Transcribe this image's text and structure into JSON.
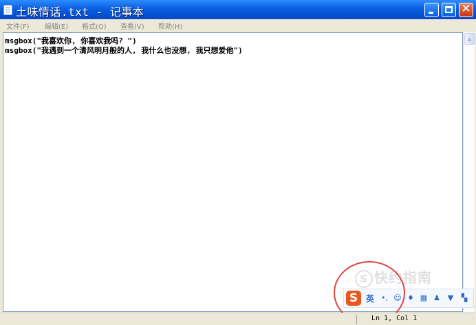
{
  "window": {
    "title": "土味情话.txt - 记事本",
    "controls": {
      "minimize": "_",
      "maximize": "□",
      "close": "✕"
    }
  },
  "menu": [
    {
      "label": "文件(F)"
    },
    {
      "label": "编辑(E)"
    },
    {
      "label": "格式(O)"
    },
    {
      "label": "查看(V)"
    },
    {
      "label": "帮助(H)"
    }
  ],
  "editor": {
    "lines": [
      "msgbox(\"我喜欢你, 你喜欢我吗? \")",
      "msgbox(\"我遇到一个清风明月般的人, 我什么也没想, 我只想爱他\")"
    ]
  },
  "status": {
    "position": "Ln 1, Col 1"
  },
  "ime": {
    "logo": "S",
    "language": "英",
    "icons": [
      "punctuation-icon",
      "emoji-icon",
      "microphone-icon",
      "keyboard-icon",
      "user-icon",
      "skin-icon",
      "toolbox-icon"
    ]
  },
  "watermark": {
    "badge": "S",
    "text": "快约指南"
  },
  "colors": {
    "titlebar": "#0A5FE0",
    "close_button": "#C53412",
    "ime_logo": "#E8571B",
    "highlight_circle": "#E24343"
  }
}
